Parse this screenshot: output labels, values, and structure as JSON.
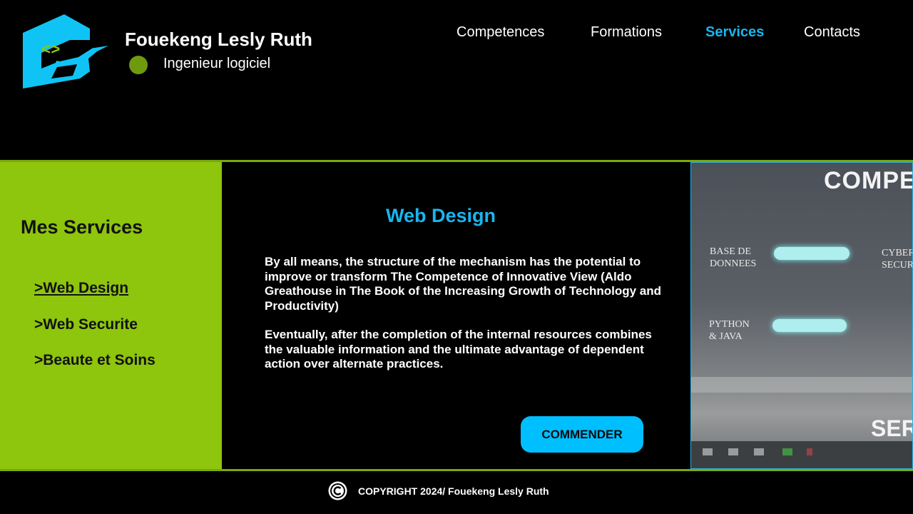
{
  "header": {
    "name": "Fouekeng Lesly Ruth",
    "role": "Ingenieur logiciel",
    "logo_icon": "code-shield-logo",
    "logo_code": "<>",
    "nav": [
      {
        "label": "Competences",
        "active": false
      },
      {
        "label": "Formations",
        "active": false
      },
      {
        "label": "Services",
        "active": true
      },
      {
        "label": "Contacts",
        "active": false
      }
    ]
  },
  "sidebar": {
    "title": "Mes Services",
    "items": [
      {
        "label": ">Web Design",
        "active": true
      },
      {
        "label": ">Web Securite",
        "active": false
      },
      {
        "label": ">Beaute et Soins",
        "active": false
      }
    ]
  },
  "content": {
    "title": "Web Design",
    "paragraph1": "By all means, the structure of the mechanism has the potential to improve or transform The Competence of Innovative View (Aldo Greathouse in The Book of the Increasing Growth of Technology and Productivity)",
    "paragraph2": "Eventually, after the completion of the internal resources combines the valuable information and the ultimate advantage of dependent action over alternate practices.",
    "button": "COMMENDER"
  },
  "preview": {
    "top_text": "COMPE",
    "label1": "BASE DE\nDONNEES",
    "label2": "PYTHON\n& JAVA",
    "label3": "CYBER\nSECUR",
    "bottom_text": "SER"
  },
  "footer": {
    "copyright": "COPYRIGHT 2024/ Fouekeng Lesly Ruth"
  },
  "colors": {
    "accent": "#18b6ef",
    "green": "#8ec50d",
    "background": "#000000"
  }
}
